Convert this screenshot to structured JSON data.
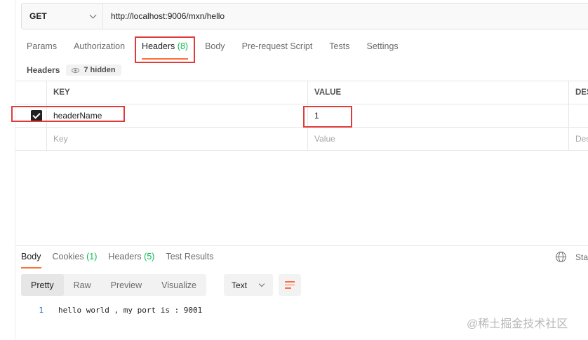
{
  "request": {
    "method": "GET",
    "url": "http://localhost:9006/mxn/hello"
  },
  "request_tabs": [
    {
      "label": "Params",
      "count": ""
    },
    {
      "label": "Authorization",
      "count": ""
    },
    {
      "label": "Headers ",
      "count": "(8)"
    },
    {
      "label": "Body",
      "count": ""
    },
    {
      "label": "Pre-request Script",
      "count": ""
    },
    {
      "label": "Tests",
      "count": ""
    },
    {
      "label": "Settings",
      "count": ""
    }
  ],
  "headers_section": {
    "label": "Headers",
    "hidden_label": "7 hidden"
  },
  "headers_table": {
    "columns": [
      "KEY",
      "VALUE",
      "DES"
    ],
    "rows": [
      {
        "checked": true,
        "key": "headerName",
        "value": "1",
        "description": ""
      }
    ],
    "placeholder": {
      "key": "Key",
      "value": "Value",
      "description": "Des"
    }
  },
  "response": {
    "tabs": [
      {
        "label": "Body",
        "count": ""
      },
      {
        "label": "Cookies ",
        "count": "(1)"
      },
      {
        "label": "Headers ",
        "count": "(5)"
      },
      {
        "label": "Test Results",
        "count": ""
      }
    ],
    "status_partial": "Sta",
    "view_modes": [
      "Pretty",
      "Raw",
      "Preview",
      "Visualize"
    ],
    "format": "Text",
    "lines": [
      {
        "num": "1",
        "text": "hello world , my port is : 9001"
      }
    ]
  },
  "watermark": "@稀土掘金技术社区",
  "colors": {
    "accent": "#ff6c37",
    "count_green": "#0cbb52",
    "annotation_red": "#e03b3b"
  }
}
